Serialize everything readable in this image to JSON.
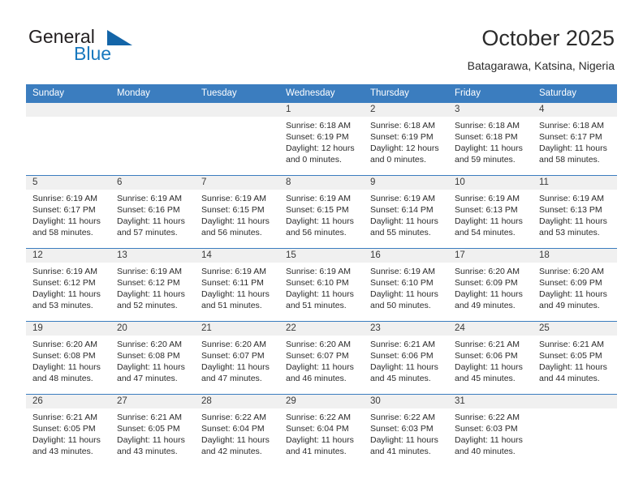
{
  "brand": {
    "name_line1": "General",
    "name_line2": "Blue",
    "accent_color": "#1878be",
    "triangle_color": "#1465a8"
  },
  "header": {
    "title": "October 2025",
    "subtitle": "Batagarawa, Katsina, Nigeria"
  },
  "theme": {
    "header_bg": "#3b7dbf",
    "header_text": "#ffffff",
    "daynum_bg": "#f0f0f0",
    "grid_line": "#3b7dbf"
  },
  "weekdays": [
    "Sunday",
    "Monday",
    "Tuesday",
    "Wednesday",
    "Thursday",
    "Friday",
    "Saturday"
  ],
  "weeks": [
    [
      {
        "day": "",
        "lines": []
      },
      {
        "day": "",
        "lines": []
      },
      {
        "day": "",
        "lines": []
      },
      {
        "day": "1",
        "lines": [
          "Sunrise: 6:18 AM",
          "Sunset: 6:19 PM",
          "Daylight: 12 hours",
          "and 0 minutes."
        ]
      },
      {
        "day": "2",
        "lines": [
          "Sunrise: 6:18 AM",
          "Sunset: 6:19 PM",
          "Daylight: 12 hours",
          "and 0 minutes."
        ]
      },
      {
        "day": "3",
        "lines": [
          "Sunrise: 6:18 AM",
          "Sunset: 6:18 PM",
          "Daylight: 11 hours",
          "and 59 minutes."
        ]
      },
      {
        "day": "4",
        "lines": [
          "Sunrise: 6:18 AM",
          "Sunset: 6:17 PM",
          "Daylight: 11 hours",
          "and 58 minutes."
        ]
      }
    ],
    [
      {
        "day": "5",
        "lines": [
          "Sunrise: 6:19 AM",
          "Sunset: 6:17 PM",
          "Daylight: 11 hours",
          "and 58 minutes."
        ]
      },
      {
        "day": "6",
        "lines": [
          "Sunrise: 6:19 AM",
          "Sunset: 6:16 PM",
          "Daylight: 11 hours",
          "and 57 minutes."
        ]
      },
      {
        "day": "7",
        "lines": [
          "Sunrise: 6:19 AM",
          "Sunset: 6:15 PM",
          "Daylight: 11 hours",
          "and 56 minutes."
        ]
      },
      {
        "day": "8",
        "lines": [
          "Sunrise: 6:19 AM",
          "Sunset: 6:15 PM",
          "Daylight: 11 hours",
          "and 56 minutes."
        ]
      },
      {
        "day": "9",
        "lines": [
          "Sunrise: 6:19 AM",
          "Sunset: 6:14 PM",
          "Daylight: 11 hours",
          "and 55 minutes."
        ]
      },
      {
        "day": "10",
        "lines": [
          "Sunrise: 6:19 AM",
          "Sunset: 6:13 PM",
          "Daylight: 11 hours",
          "and 54 minutes."
        ]
      },
      {
        "day": "11",
        "lines": [
          "Sunrise: 6:19 AM",
          "Sunset: 6:13 PM",
          "Daylight: 11 hours",
          "and 53 minutes."
        ]
      }
    ],
    [
      {
        "day": "12",
        "lines": [
          "Sunrise: 6:19 AM",
          "Sunset: 6:12 PM",
          "Daylight: 11 hours",
          "and 53 minutes."
        ]
      },
      {
        "day": "13",
        "lines": [
          "Sunrise: 6:19 AM",
          "Sunset: 6:12 PM",
          "Daylight: 11 hours",
          "and 52 minutes."
        ]
      },
      {
        "day": "14",
        "lines": [
          "Sunrise: 6:19 AM",
          "Sunset: 6:11 PM",
          "Daylight: 11 hours",
          "and 51 minutes."
        ]
      },
      {
        "day": "15",
        "lines": [
          "Sunrise: 6:19 AM",
          "Sunset: 6:10 PM",
          "Daylight: 11 hours",
          "and 51 minutes."
        ]
      },
      {
        "day": "16",
        "lines": [
          "Sunrise: 6:19 AM",
          "Sunset: 6:10 PM",
          "Daylight: 11 hours",
          "and 50 minutes."
        ]
      },
      {
        "day": "17",
        "lines": [
          "Sunrise: 6:20 AM",
          "Sunset: 6:09 PM",
          "Daylight: 11 hours",
          "and 49 minutes."
        ]
      },
      {
        "day": "18",
        "lines": [
          "Sunrise: 6:20 AM",
          "Sunset: 6:09 PM",
          "Daylight: 11 hours",
          "and 49 minutes."
        ]
      }
    ],
    [
      {
        "day": "19",
        "lines": [
          "Sunrise: 6:20 AM",
          "Sunset: 6:08 PM",
          "Daylight: 11 hours",
          "and 48 minutes."
        ]
      },
      {
        "day": "20",
        "lines": [
          "Sunrise: 6:20 AM",
          "Sunset: 6:08 PM",
          "Daylight: 11 hours",
          "and 47 minutes."
        ]
      },
      {
        "day": "21",
        "lines": [
          "Sunrise: 6:20 AM",
          "Sunset: 6:07 PM",
          "Daylight: 11 hours",
          "and 47 minutes."
        ]
      },
      {
        "day": "22",
        "lines": [
          "Sunrise: 6:20 AM",
          "Sunset: 6:07 PM",
          "Daylight: 11 hours",
          "and 46 minutes."
        ]
      },
      {
        "day": "23",
        "lines": [
          "Sunrise: 6:21 AM",
          "Sunset: 6:06 PM",
          "Daylight: 11 hours",
          "and 45 minutes."
        ]
      },
      {
        "day": "24",
        "lines": [
          "Sunrise: 6:21 AM",
          "Sunset: 6:06 PM",
          "Daylight: 11 hours",
          "and 45 minutes."
        ]
      },
      {
        "day": "25",
        "lines": [
          "Sunrise: 6:21 AM",
          "Sunset: 6:05 PM",
          "Daylight: 11 hours",
          "and 44 minutes."
        ]
      }
    ],
    [
      {
        "day": "26",
        "lines": [
          "Sunrise: 6:21 AM",
          "Sunset: 6:05 PM",
          "Daylight: 11 hours",
          "and 43 minutes."
        ]
      },
      {
        "day": "27",
        "lines": [
          "Sunrise: 6:21 AM",
          "Sunset: 6:05 PM",
          "Daylight: 11 hours",
          "and 43 minutes."
        ]
      },
      {
        "day": "28",
        "lines": [
          "Sunrise: 6:22 AM",
          "Sunset: 6:04 PM",
          "Daylight: 11 hours",
          "and 42 minutes."
        ]
      },
      {
        "day": "29",
        "lines": [
          "Sunrise: 6:22 AM",
          "Sunset: 6:04 PM",
          "Daylight: 11 hours",
          "and 41 minutes."
        ]
      },
      {
        "day": "30",
        "lines": [
          "Sunrise: 6:22 AM",
          "Sunset: 6:03 PM",
          "Daylight: 11 hours",
          "and 41 minutes."
        ]
      },
      {
        "day": "31",
        "lines": [
          "Sunrise: 6:22 AM",
          "Sunset: 6:03 PM",
          "Daylight: 11 hours",
          "and 40 minutes."
        ]
      },
      {
        "day": "",
        "lines": []
      }
    ]
  ]
}
